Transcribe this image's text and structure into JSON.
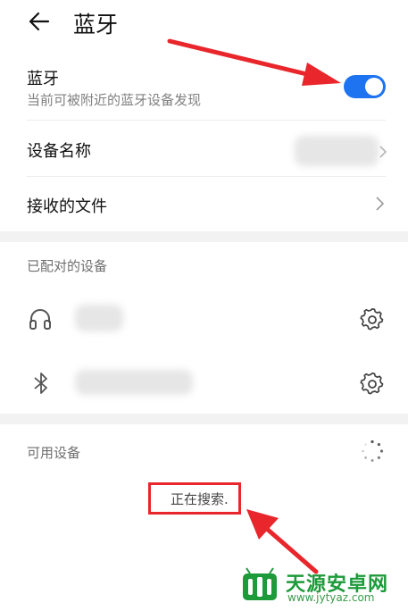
{
  "header": {
    "title": "蓝牙"
  },
  "bluetooth": {
    "label": "蓝牙",
    "subtitle": "当前可被附近的蓝牙设备发现",
    "enabled": true,
    "toggle_color": "#1e73f0"
  },
  "device_name": {
    "label": "设备名称"
  },
  "received_files": {
    "label": "接收的文件"
  },
  "paired": {
    "title": "已配对的设备",
    "devices": [
      {
        "icon": "headphones-icon"
      },
      {
        "icon": "bluetooth-icon"
      }
    ]
  },
  "available": {
    "title": "可用设备",
    "searching_text": "正在搜索."
  },
  "annotation_color": "#e8262b",
  "watermark": {
    "title": "天源安卓网",
    "url": "www.jytyaz.com"
  }
}
